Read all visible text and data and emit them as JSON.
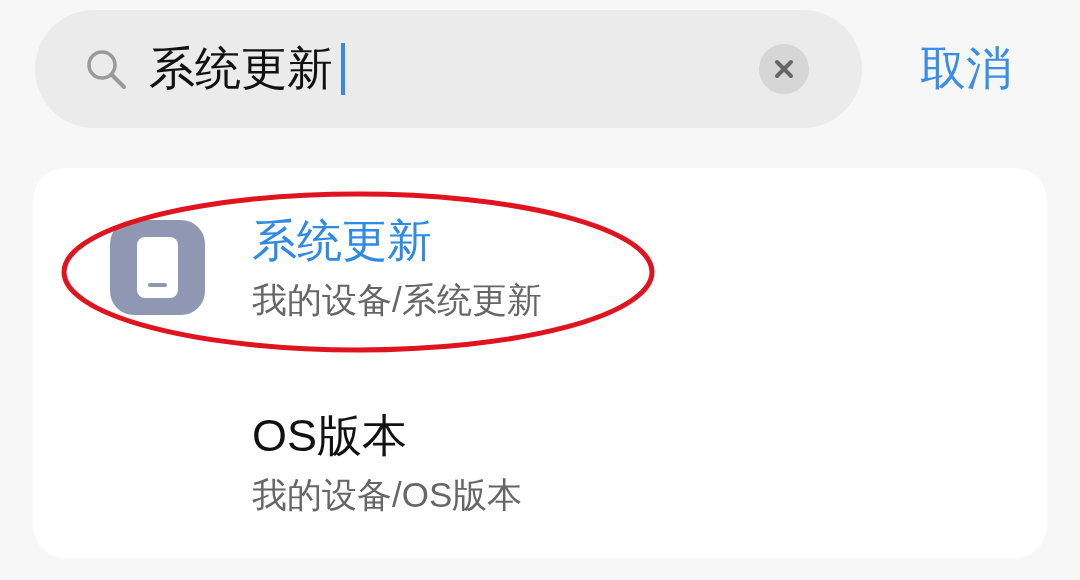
{
  "search": {
    "value": "系统更新",
    "cancel": "取消"
  },
  "results": [
    {
      "title": "系统更新",
      "path": "我的设备/系统更新",
      "matched": true,
      "highlighted": true,
      "kind": "app"
    },
    {
      "title": "OS版本",
      "path": "我的设备/OS版本",
      "matched": false,
      "highlighted": false,
      "kind": "plain"
    }
  ]
}
